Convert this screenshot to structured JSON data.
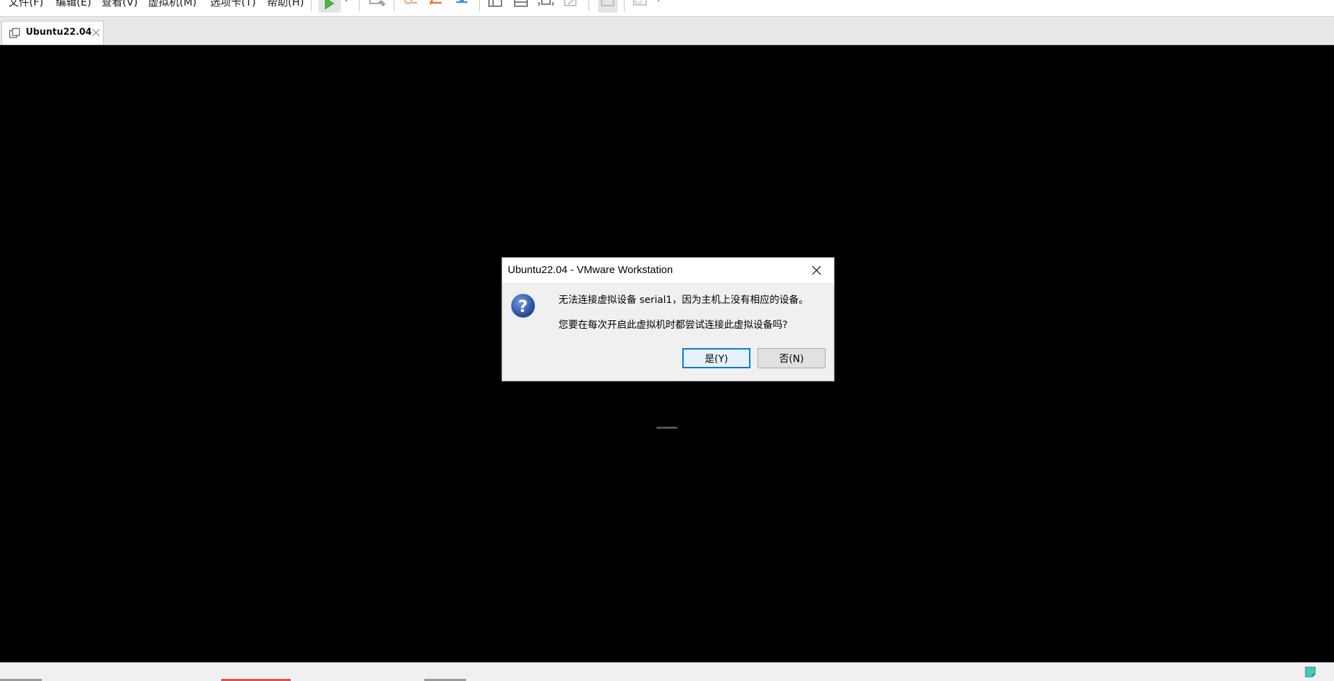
{
  "menu": {
    "items": [
      "文件(F)",
      "编辑(E)",
      "查看(V)",
      "虚拟机(M)",
      "选项卡(T)",
      "帮助(H)"
    ]
  },
  "toolbar": {
    "icons": [
      "power-on-icon",
      "send-ctrl-alt-del-icon",
      "snapshot-take-icon",
      "snapshot-revert-icon",
      "snapshot-manager-icon",
      "show-library-icon",
      "thumbnail-bar-icon",
      "full-screen-icon",
      "unity-icon",
      "console-view-icon",
      "stretch-guest-icon"
    ]
  },
  "tabs": [
    {
      "label": "Ubuntu22.04",
      "active": true
    }
  ],
  "dialog": {
    "title": "Ubuntu22.04 - VMware Workstation",
    "message_line1": "无法连接虚拟设备 serial1，因为主机上没有相应的设备。",
    "message_line2": "您要在每次开启此虚拟机时都尝试连接此虚拟设备吗?",
    "yes_label": "是(Y)",
    "no_label": "否(N)",
    "icon": "question-icon"
  },
  "colors": {
    "console_bg": "#000000",
    "accent": "#0078d7",
    "dialog_bg": "#f0f0f0",
    "play_green": "#4caf50",
    "snapshot_orange": "#e8743b",
    "snapshot_blue": "#3a8fd8"
  }
}
